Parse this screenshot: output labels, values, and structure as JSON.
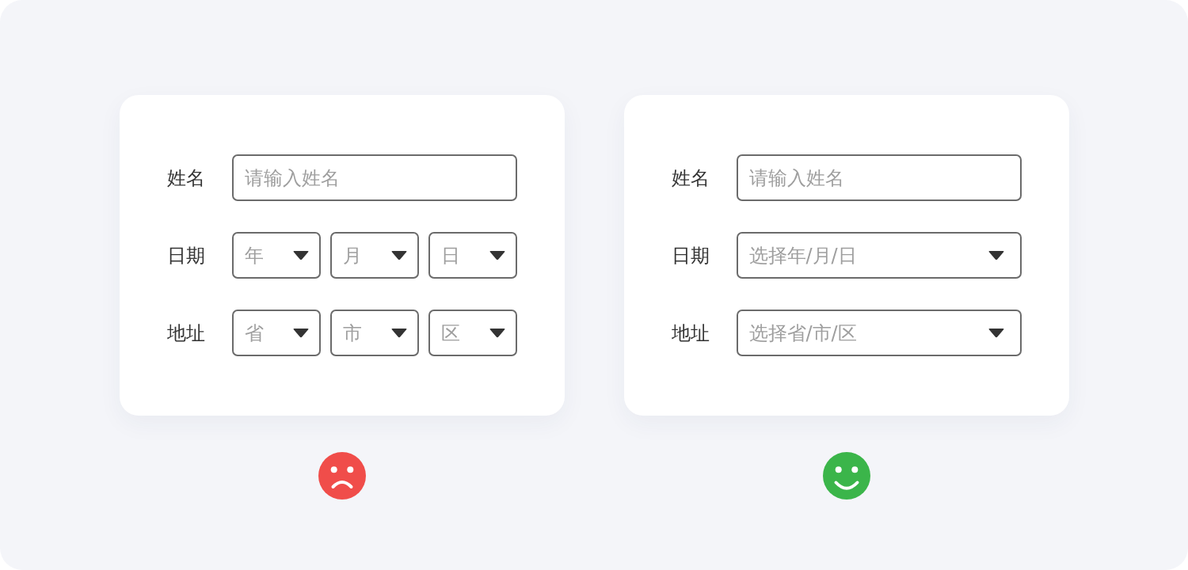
{
  "panels": [
    {
      "rows": [
        {
          "label": "姓名",
          "controls": [
            {
              "kind": "input",
              "placeholder": "请输入姓名"
            }
          ]
        },
        {
          "label": "日期",
          "controls": [
            {
              "kind": "select",
              "placeholder": "年"
            },
            {
              "kind": "select",
              "placeholder": "月"
            },
            {
              "kind": "select",
              "placeholder": "日"
            }
          ]
        },
        {
          "label": "地址",
          "controls": [
            {
              "kind": "select",
              "placeholder": "省"
            },
            {
              "kind": "select",
              "placeholder": "市"
            },
            {
              "kind": "select",
              "placeholder": "区"
            }
          ]
        }
      ],
      "verdict": {
        "kind": "sad",
        "color": "#f04d4a"
      }
    },
    {
      "rows": [
        {
          "label": "姓名",
          "controls": [
            {
              "kind": "input",
              "placeholder": "请输入姓名"
            }
          ]
        },
        {
          "label": "日期",
          "controls": [
            {
              "kind": "select",
              "placeholder": "选择年/月/日"
            }
          ]
        },
        {
          "label": "地址",
          "controls": [
            {
              "kind": "select",
              "placeholder": "选择省/市/区"
            }
          ]
        }
      ],
      "verdict": {
        "kind": "happy",
        "color": "#3bb54a"
      }
    }
  ]
}
